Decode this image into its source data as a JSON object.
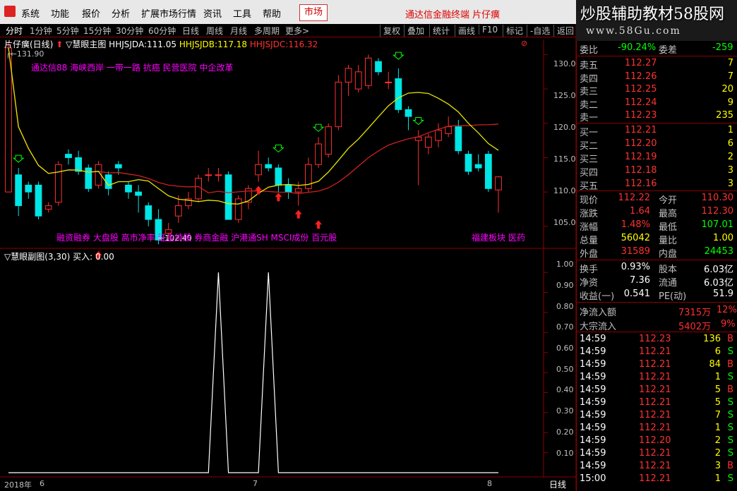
{
  "menubar": {
    "items": [
      "系统",
      "功能",
      "报价",
      "分析",
      "扩展市场行情",
      "资讯",
      "工具",
      "帮助"
    ],
    "market_button": "市场",
    "brand": "通达信金融终端  片仔癀",
    "watermark_title": "炒股辅助教材58股网",
    "watermark_url": "www.58Gu.com"
  },
  "tabs": {
    "left": [
      "分时",
      "1分钟",
      "5分钟",
      "15分钟",
      "30分钟",
      "60分钟",
      "日线",
      "周线",
      "月线",
      "多周期",
      "更多>"
    ],
    "right": [
      "复权",
      "叠加",
      "统计",
      "画线",
      "F10",
      "标记",
      "-自选",
      "返回"
    ]
  },
  "main_chart": {
    "stock": "片仔癀(日线)",
    "indicator_name": "慧眼主图",
    "hhjsjda_label": "HHJSJDA:",
    "hhjsjda_value": "111.05",
    "hhjsjdb_label": "HHJSJDB:",
    "hhjsjdb_value": "117.18",
    "hhjsjdc_label": "HHJSJDC:",
    "hhjsjdc_value": "116.32",
    "high_marker": "131.90",
    "low_marker": "102.40",
    "concepts_top": "通达信88 海峡西岸 一带一路 抗癌 民营医院 中企改革",
    "concepts_bottom": "融资融券 大盘股 高市净率 证金持股 券商金融 沪港通SH MSCI成份 百元股",
    "concepts_right": "福建板块 医药",
    "y_ticks": [
      "130.0",
      "125.0",
      "120.0",
      "115.0",
      "110.0",
      "105.0"
    ],
    "accent_up": "#ff3030",
    "accent_down": "#00e5e5"
  },
  "sub_chart": {
    "indicator_name": "慧眼副图(3,30)",
    "buy_label": "买入:",
    "buy_value": "0.00",
    "y_ticks": [
      "1.00",
      "0.90",
      "0.80",
      "0.70",
      "0.60",
      "0.50",
      "0.40",
      "0.30",
      "0.20",
      "0.10"
    ]
  },
  "date_axis": {
    "labels": [
      "2018年",
      "6",
      "7",
      "8"
    ],
    "period": "日线"
  },
  "quote_panel": {
    "wei_bi_label": "委比",
    "wei_bi_value": "-90.24%",
    "wei_cha_label": "委差",
    "wei_cha_value": "-259",
    "asks": [
      {
        "label": "卖五",
        "price": "112.27",
        "vol": "7"
      },
      {
        "label": "卖四",
        "price": "112.26",
        "vol": "7"
      },
      {
        "label": "卖三",
        "price": "112.25",
        "vol": "20"
      },
      {
        "label": "卖二",
        "price": "112.24",
        "vol": "9"
      },
      {
        "label": "卖一",
        "price": "112.23",
        "vol": "235"
      }
    ],
    "bids": [
      {
        "label": "买一",
        "price": "112.21",
        "vol": "1"
      },
      {
        "label": "买二",
        "price": "112.20",
        "vol": "6"
      },
      {
        "label": "买三",
        "price": "112.19",
        "vol": "2"
      },
      {
        "label": "买四",
        "price": "112.18",
        "vol": "3"
      },
      {
        "label": "买五",
        "price": "112.16",
        "vol": "3"
      }
    ],
    "stats": [
      {
        "l1": "现价",
        "v1": "112.22",
        "c1": "red",
        "l2": "今开",
        "v2": "110.30",
        "c2": "red"
      },
      {
        "l1": "涨跌",
        "v1": "1.64",
        "c1": "red",
        "l2": "最高",
        "v2": "112.30",
        "c2": "red"
      },
      {
        "l1": "涨幅",
        "v1": "1.48%",
        "c1": "red",
        "l2": "最低",
        "v2": "107.01",
        "c2": "green"
      },
      {
        "l1": "总量",
        "v1": "56042",
        "c1": "yellow",
        "l2": "量比",
        "v2": "1.00",
        "c2": "yellow"
      },
      {
        "l1": "外盘",
        "v1": "31589",
        "c1": "red",
        "l2": "内盘",
        "v2": "24453",
        "c2": "green"
      }
    ],
    "stats2": [
      {
        "l1": "换手",
        "v1": "0.93%",
        "l2": "股本",
        "v2": "6.03亿"
      },
      {
        "l1": "净资",
        "v1": "7.36",
        "l2": "流通",
        "v2": "6.03亿"
      },
      {
        "l1": "收益(一)",
        "v1": "0.541",
        "l2": "PE(动)",
        "v2": "51.9"
      }
    ],
    "net_inflow_label": "净流入额",
    "net_inflow_value": "7315万",
    "net_inflow_pct": "12%",
    "block_inflow_label": "大宗流入",
    "block_inflow_value": "5402万",
    "block_inflow_pct": "9%",
    "ticks": [
      {
        "time": "14:59",
        "price": "112.23",
        "vol": "136",
        "side": "B"
      },
      {
        "time": "14:59",
        "price": "112.21",
        "vol": "6",
        "side": "S"
      },
      {
        "time": "14:59",
        "price": "112.21",
        "vol": "84",
        "side": "B"
      },
      {
        "time": "14:59",
        "price": "112.21",
        "vol": "1",
        "side": "S"
      },
      {
        "time": "14:59",
        "price": "112.21",
        "vol": "5",
        "side": "B"
      },
      {
        "time": "14:59",
        "price": "112.21",
        "vol": "5",
        "side": "S"
      },
      {
        "time": "14:59",
        "price": "112.21",
        "vol": "7",
        "side": "S"
      },
      {
        "time": "14:59",
        "price": "112.21",
        "vol": "1",
        "side": "S"
      },
      {
        "time": "14:59",
        "price": "112.20",
        "vol": "2",
        "side": "S"
      },
      {
        "time": "14:59",
        "price": "112.21",
        "vol": "2",
        "side": "S"
      },
      {
        "time": "14:59",
        "price": "112.21",
        "vol": "3",
        "side": "B"
      },
      {
        "time": "15:00",
        "price": "112.21",
        "vol": "1",
        "side": "S"
      }
    ]
  },
  "chart_data": {
    "type": "candlestick",
    "y_range": [
      102,
      132
    ],
    "candles": [
      {
        "o": 110.0,
        "c": 131.0,
        "h": 131.9,
        "l": 110.0
      },
      {
        "o": 112.5,
        "c": 108.0,
        "h": 113.5,
        "l": 106.5
      },
      {
        "o": 111.0,
        "c": 110.0,
        "h": 111.5,
        "l": 109.0
      },
      {
        "o": 111.0,
        "c": 106.5,
        "h": 111.5,
        "l": 106.0
      },
      {
        "o": 107.5,
        "c": 108.0,
        "h": 108.5,
        "l": 107.0
      },
      {
        "o": 108.5,
        "c": 114.0,
        "h": 114.5,
        "l": 108.0
      },
      {
        "o": 115.5,
        "c": 115.0,
        "h": 116.2,
        "l": 114.0
      },
      {
        "o": 115.0,
        "c": 113.0,
        "h": 116.0,
        "l": 112.5
      },
      {
        "o": 113.5,
        "c": 110.5,
        "h": 114.0,
        "l": 110.0
      },
      {
        "o": 111.0,
        "c": 114.0,
        "h": 114.5,
        "l": 110.5
      },
      {
        "o": 112.5,
        "c": 110.5,
        "h": 113.0,
        "l": 109.5
      },
      {
        "o": 114.0,
        "c": 113.5,
        "h": 114.5,
        "l": 112.5
      },
      {
        "o": 111.0,
        "c": 110.0,
        "h": 111.5,
        "l": 109.0
      },
      {
        "o": 110.0,
        "c": 109.5,
        "h": 111.0,
        "l": 107.0
      },
      {
        "o": 108.0,
        "c": 106.0,
        "h": 108.5,
        "l": 105.0
      },
      {
        "o": 106.0,
        "c": 103.0,
        "h": 107.5,
        "l": 102.4
      },
      {
        "o": 104.0,
        "c": 104.5,
        "h": 105.5,
        "l": 103.0
      },
      {
        "o": 106.5,
        "c": 108.0,
        "h": 109.5,
        "l": 105.5
      },
      {
        "o": 108.0,
        "c": 109.0,
        "h": 110.0,
        "l": 107.5
      },
      {
        "o": 109.0,
        "c": 112.0,
        "h": 112.5,
        "l": 108.5
      },
      {
        "o": 112.5,
        "c": 112.5,
        "h": 113.5,
        "l": 111.5
      },
      {
        "o": 112.5,
        "c": 112.5,
        "h": 113.5,
        "l": 111.5
      },
      {
        "o": 112.5,
        "c": 106.0,
        "h": 113.0,
        "l": 106.0
      },
      {
        "o": 106.0,
        "c": 109.0,
        "h": 109.5,
        "l": 105.5
      },
      {
        "o": 108.5,
        "c": 110.5,
        "h": 111.0,
        "l": 107.5
      },
      {
        "o": 112.5,
        "c": 114.0,
        "h": 116.0,
        "l": 111.5
      },
      {
        "o": 114.0,
        "c": 113.5,
        "h": 115.0,
        "l": 113.0
      },
      {
        "o": 113.5,
        "c": 111.0,
        "h": 114.0,
        "l": 110.0
      },
      {
        "o": 111.0,
        "c": 110.0,
        "h": 112.0,
        "l": 109.0
      },
      {
        "o": 110.0,
        "c": 110.5,
        "h": 111.5,
        "l": 108.0
      },
      {
        "o": 110.5,
        "c": 114.0,
        "h": 115.0,
        "l": 110.0
      },
      {
        "o": 114.0,
        "c": 117.0,
        "h": 118.0,
        "l": 113.5
      },
      {
        "o": 115.5,
        "c": 119.5,
        "h": 120.0,
        "l": 115.0
      },
      {
        "o": 119.5,
        "c": 126.0,
        "h": 127.0,
        "l": 119.0
      },
      {
        "o": 126.0,
        "c": 128.0,
        "h": 128.5,
        "l": 124.0
      },
      {
        "o": 125.0,
        "c": 127.5,
        "h": 128.5,
        "l": 124.5
      },
      {
        "o": 125.5,
        "c": 129.5,
        "h": 130.0,
        "l": 125.0
      },
      {
        "o": 129.0,
        "c": 127.5,
        "h": 129.5,
        "l": 127.0
      },
      {
        "o": 126.0,
        "c": 126.0,
        "h": 127.5,
        "l": 125.0
      },
      {
        "o": 126.5,
        "c": 122.0,
        "h": 128.0,
        "l": 121.5
      },
      {
        "o": 122.0,
        "c": 121.0,
        "h": 122.5,
        "l": 119.0
      },
      {
        "o": 117.5,
        "c": 118.0,
        "h": 119.0,
        "l": 111.0
      },
      {
        "o": 116.5,
        "c": 118.0,
        "h": 118.5,
        "l": 115.5
      },
      {
        "o": 117.5,
        "c": 119.0,
        "h": 120.0,
        "l": 116.5
      },
      {
        "o": 118.5,
        "c": 119.5,
        "h": 121.0,
        "l": 118.0
      },
      {
        "o": 119.5,
        "c": 116.0,
        "h": 120.5,
        "l": 115.5
      },
      {
        "o": 115.5,
        "c": 113.0,
        "h": 116.0,
        "l": 112.5
      },
      {
        "o": 114.0,
        "c": 113.5,
        "h": 115.5,
        "l": 113.0
      },
      {
        "o": 115.5,
        "c": 110.5,
        "h": 116.0,
        "l": 110.0
      },
      {
        "o": 110.3,
        "c": 112.2,
        "h": 112.3,
        "l": 107.0
      }
    ],
    "sub_series": [
      0,
      0,
      0,
      0,
      0,
      0,
      0,
      0,
      0,
      0,
      0,
      0,
      0,
      0,
      0,
      0,
      0,
      0,
      0,
      0,
      0,
      1,
      0,
      0,
      0,
      0,
      1,
      0,
      0,
      0,
      0,
      0,
      0,
      0,
      0,
      0,
      0,
      0,
      0,
      0,
      0,
      0,
      0,
      0,
      0,
      0,
      0,
      0,
      0,
      0
    ],
    "sub_y_range": [
      0,
      1.05
    ]
  }
}
